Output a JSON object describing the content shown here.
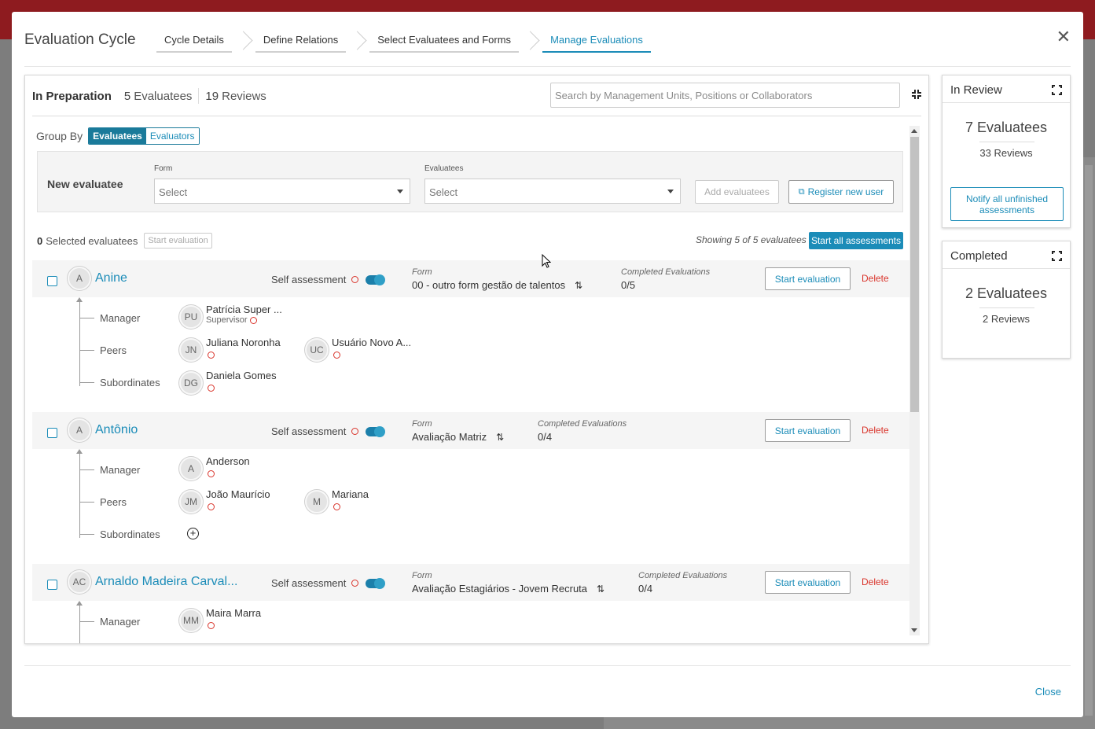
{
  "modal": {
    "title": "Evaluation Cycle",
    "close_label": "Close",
    "steps": [
      {
        "label": "Cycle Details"
      },
      {
        "label": "Define Relations"
      },
      {
        "label": "Select Evaluatees and Forms"
      },
      {
        "label": "Manage Evaluations"
      }
    ],
    "active_step": "Manage Evaluations"
  },
  "main": {
    "status": "In Preparation",
    "evaluatees_count": "5",
    "evaluatees_label": "Evaluatees",
    "reviews_count": "19",
    "reviews_label": "Reviews",
    "search_placeholder": "Search by Management Units, Positions or Collaborators",
    "group_by_label": "Group By",
    "group_by_options": [
      "Evaluatees",
      "Evaluators"
    ],
    "group_by_selected": "Evaluatees",
    "new_evaluatee": {
      "title": "New evaluatee",
      "form_label": "Form",
      "form_value": "Select",
      "evaluatees_label": "Evaluatees",
      "evaluatees_value": "Select",
      "add_button": "Add evaluatees",
      "register_button": "Register new user"
    },
    "selected_count": "0",
    "selected_label": "Selected evaluatees",
    "start_evaluation_disabled": "Start evaluation",
    "showing_text": "Showing 5 of 5 evaluatees",
    "start_all_button": "Start all assessments",
    "self_assessment_label": "Self assessment",
    "form_label": "Form",
    "completed_label": "Completed Evaluations",
    "start_button": "Start evaluation",
    "delete_button": "Delete",
    "relation_labels": {
      "manager": "Manager",
      "peers": "Peers",
      "subordinates": "Subordinates"
    },
    "evaluatees": [
      {
        "initials": "A",
        "name": "Anine",
        "form": "00 - outro form gestão de talentos",
        "completed": "0/5",
        "manager": [
          {
            "initials": "PU",
            "name": "Patrícia Super ...",
            "sub": "Supervisor"
          }
        ],
        "peers": [
          {
            "initials": "JN",
            "name": "Juliana Noronha"
          },
          {
            "initials": "UC",
            "name": "Usuário Novo A..."
          }
        ],
        "subordinates": [
          {
            "initials": "DG",
            "name": "Daniela Gomes"
          }
        ]
      },
      {
        "initials": "A",
        "name": "Antônio",
        "form": "Avaliação Matriz",
        "completed": "0/4",
        "manager": [
          {
            "initials": "A",
            "name": "Anderson"
          }
        ],
        "peers": [
          {
            "initials": "JM",
            "name": "João Maurício"
          },
          {
            "initials": "M",
            "name": "Mariana"
          }
        ],
        "subordinates": []
      },
      {
        "initials": "AC",
        "name": "Arnaldo Madeira Carval...",
        "form": "Avaliação Estagiários - Jovem Recruta",
        "completed": "0/4",
        "manager": [
          {
            "initials": "MM",
            "name": "Maira Marra"
          }
        ],
        "peers": [],
        "subordinates": []
      }
    ]
  },
  "in_review": {
    "title": "In Review",
    "evaluatees_text": "7 Evaluatees",
    "reviews_text": "33 Reviews",
    "notify_button": "Notify all unfinished assessments"
  },
  "completed": {
    "title": "Completed",
    "evaluatees_text": "2 Evaluatees",
    "reviews_text": "2 Reviews"
  },
  "colors": {
    "accent": "#1b8cb8",
    "danger": "#d9342b",
    "topbar": "#8e1b1f"
  },
  "icons": [
    "close-icon",
    "collapse-icon",
    "expand-icon",
    "swap-icon",
    "external-link-icon",
    "add-circle-icon",
    "caret-down-icon"
  ]
}
